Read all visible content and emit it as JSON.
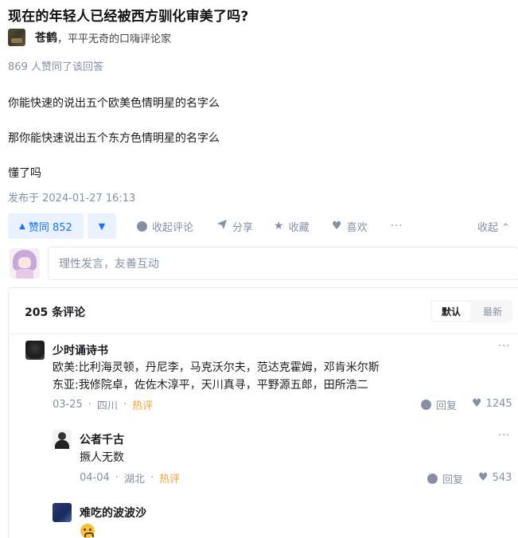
{
  "question": {
    "title": "现在的年轻人已经被西方驯化审美了吗?"
  },
  "author": {
    "name": "苍鹤",
    "bio": "，平平无奇的口嗨评论家"
  },
  "answer": {
    "vote_summary": "869 人赞同了该回答",
    "paragraphs": [
      "你能快速的说出五个欧美色情明星的名字么",
      "那你能快速说出五个东方色情明星的名字么",
      "懂了吗"
    ],
    "publish_time": "发布于 2024-01-27 16:13"
  },
  "actions": {
    "upvote_label": "赞同 852",
    "comment_label": "收起评论",
    "share_label": "分享",
    "favorite_label": "收藏",
    "like_label": "喜欢",
    "more_label": "···",
    "fold_label": "收起 ⌃"
  },
  "comment_box": {
    "placeholder": "理性发言，友善互动"
  },
  "comments": {
    "count_label": "205 条评论",
    "sort_default": "默认",
    "sort_latest": "最新",
    "items": [
      {
        "name": "少时诵诗书",
        "lines": [
          "欧美:比利海灵顿，丹尼李，马克沃尔夫，范达克霍姆，邓肯米尔斯",
          "东亚:我修院卓，佐佐木淳平，天川真寻，平野源五郎，田所浩二"
        ],
        "date": "03-25",
        "location": "四川",
        "tag": "热评",
        "reply_label": "回复",
        "likes": "1245"
      },
      {
        "name": "公者千古",
        "lines": [
          "撅人无数"
        ],
        "date": "04-04",
        "location": "湖北",
        "tag": "热评",
        "reply_label": "回复",
        "likes": "543"
      },
      {
        "name": "难吃的波波沙"
      }
    ]
  },
  "icons": {
    "upvote": "triangle-up-icon",
    "downvote": "triangle-down-icon",
    "comment": "comment-bubble-icon",
    "share": "paper-plane-icon",
    "favorite": "star-icon",
    "like": "heart-icon",
    "more": "ellipsis-icon"
  },
  "colors": {
    "accent": "#1772f6",
    "muted": "#8590a6",
    "hot": "#f1a03a",
    "upvote_bg": "#eaf2ff"
  }
}
